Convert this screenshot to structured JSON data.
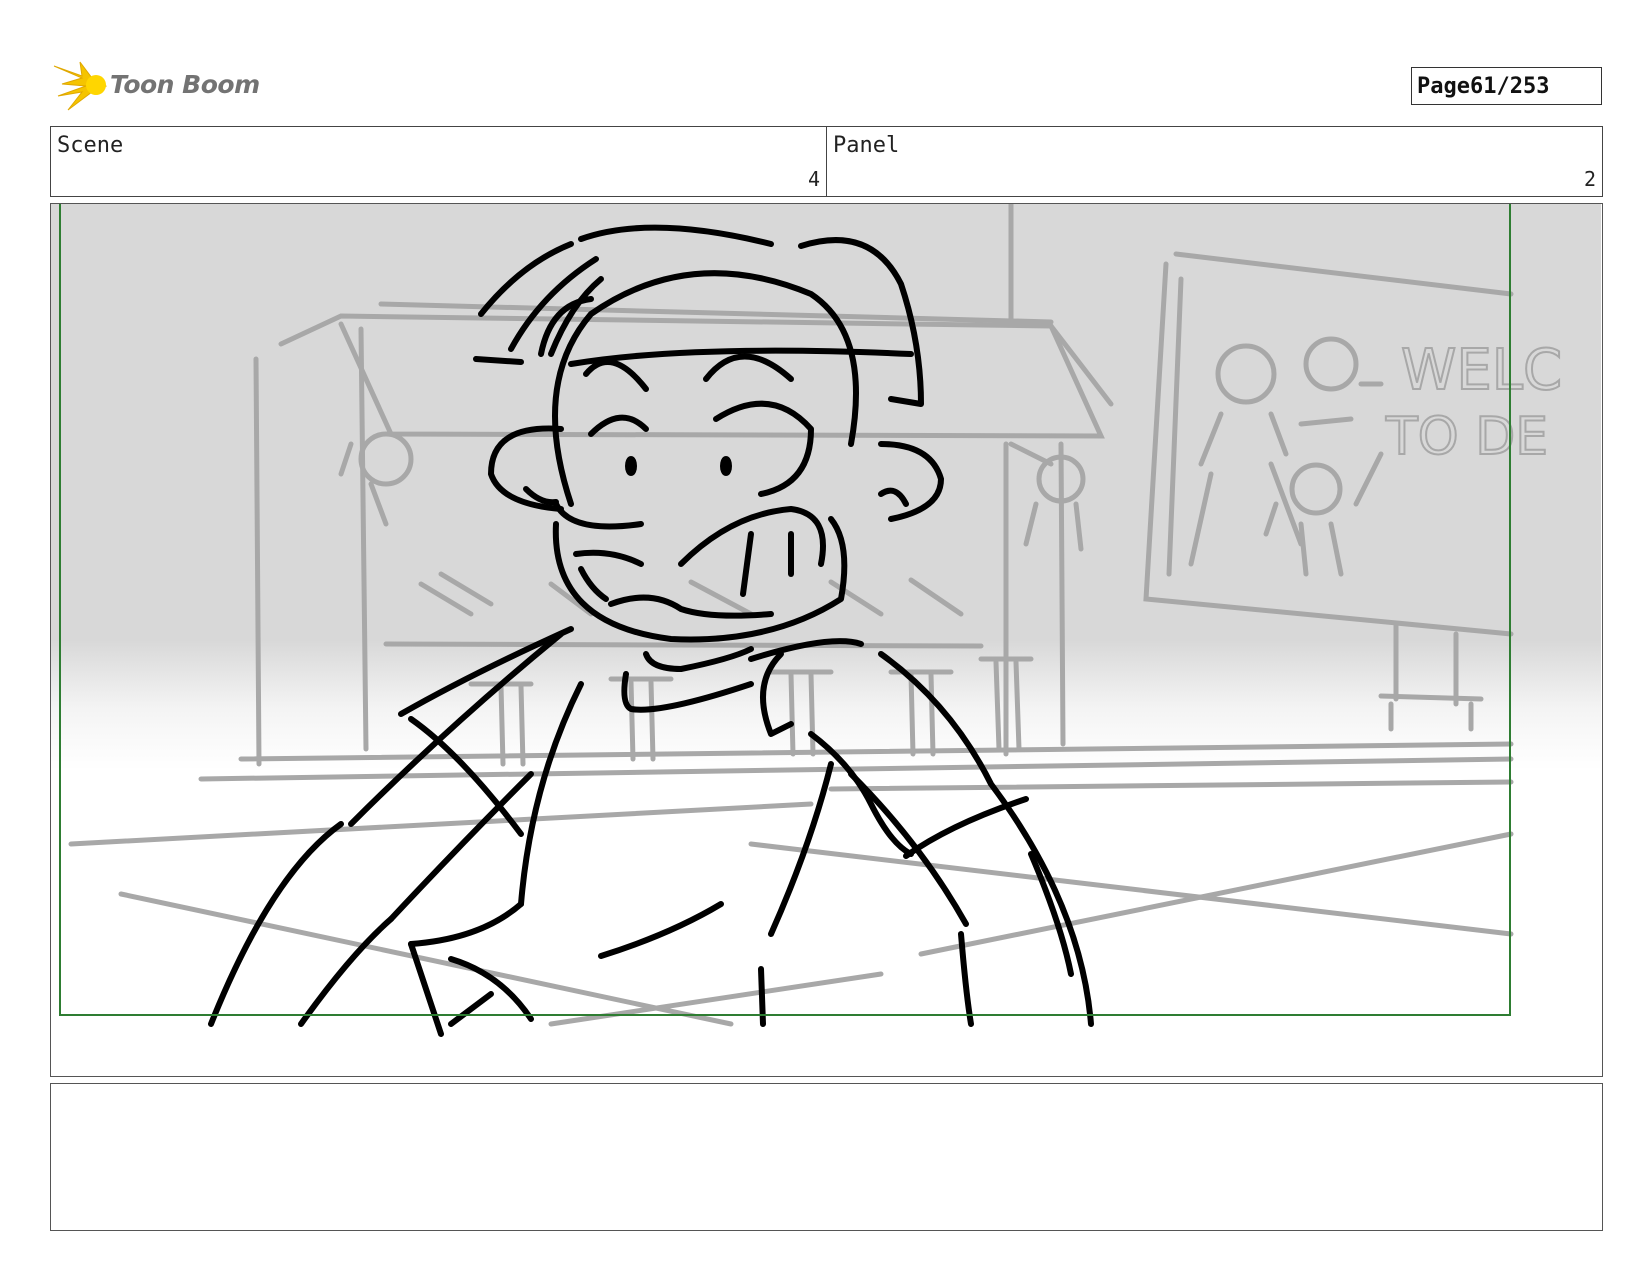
{
  "header": {
    "logo_text": "Toon Boom",
    "page_label": "Page",
    "page_value": "61/253"
  },
  "panel_info": {
    "scene_label": "Scene",
    "scene_value": "4",
    "panel_label": "Panel",
    "panel_value": "2"
  },
  "sketch": {
    "sign_text": [
      "WELC",
      "TO DE"
    ]
  },
  "notes": {
    "text": ""
  },
  "colors": {
    "safe_area_border": "#2e7d32",
    "logo_accent": "#f5c400",
    "sketch_line": "#000000",
    "background_line": "#a8a8a8"
  }
}
